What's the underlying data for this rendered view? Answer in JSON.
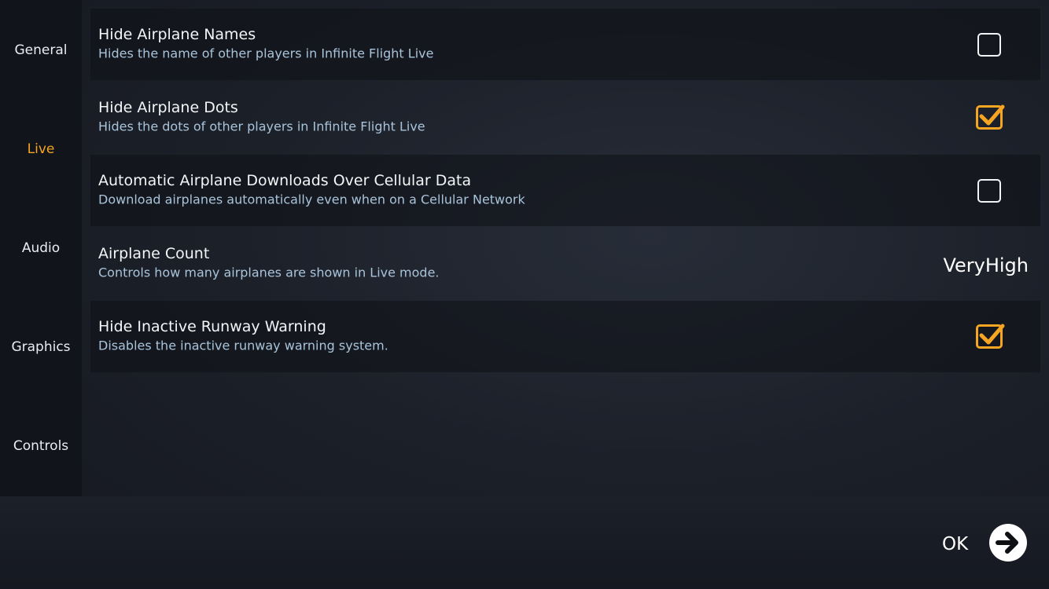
{
  "sidebar": {
    "items": [
      {
        "label": "General"
      },
      {
        "label": "Live"
      },
      {
        "label": "Audio"
      },
      {
        "label": "Graphics"
      },
      {
        "label": "Controls"
      }
    ],
    "active_item": "Live"
  },
  "settings": [
    {
      "title": "Hide Airplane Names",
      "description": "Hides the name of other players in Infinite Flight Live",
      "control": "checkbox",
      "checked": false
    },
    {
      "title": "Hide Airplane Dots",
      "description": "Hides the dots of other players in Infinite Flight Live",
      "control": "checkbox",
      "checked": true
    },
    {
      "title": "Automatic Airplane Downloads Over Cellular Data",
      "description": "Download airplanes automatically even when on a Cellular Network",
      "control": "checkbox",
      "checked": false
    },
    {
      "title": "Airplane Count",
      "description": "Controls how many airplanes are shown in Live mode.",
      "control": "value",
      "value": "VeryHigh"
    },
    {
      "title": "Hide Inactive Runway Warning",
      "description": "Disables the inactive runway warning system.",
      "control": "checkbox",
      "checked": true
    }
  ],
  "footer": {
    "ok_label": "OK",
    "ok_icon": "arrow-right-circle-icon"
  },
  "colors": {
    "accent": "#f5a521",
    "sidebar_bg": "#11141a",
    "description_text": "#a9c4da"
  }
}
